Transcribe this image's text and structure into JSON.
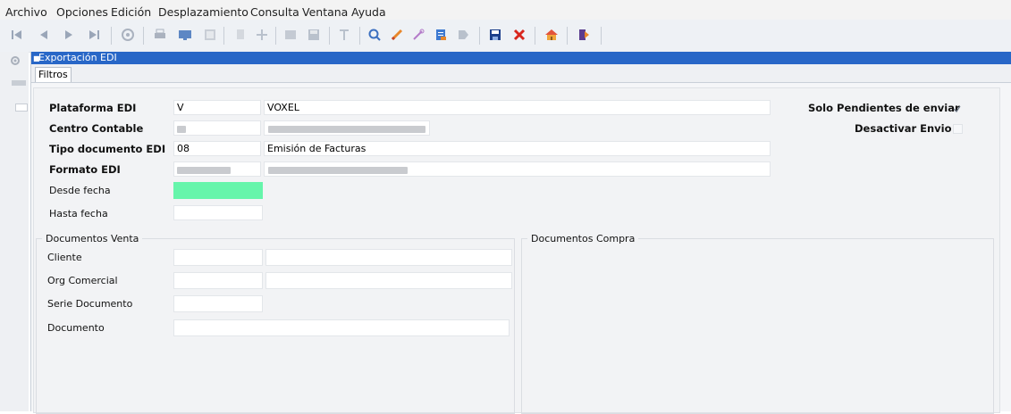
{
  "menu": [
    "Archivo",
    "Opciones",
    "Edición",
    "Desplazamiento",
    "Consulta",
    "Ventana",
    "Ayuda"
  ],
  "toolbar": {
    "icons": [
      "first-record-icon",
      "previous-record-icon",
      "next-record-icon",
      "last-record-icon",
      "globe-icon",
      "print-icon",
      "monitor-icon",
      "table-icon",
      "copy-icon",
      "add-icon",
      "form-icon",
      "save-grid-icon",
      "filter-icon",
      "search-icon",
      "pencil-icon",
      "eraser-icon",
      "document-icon",
      "tag-icon",
      "save-icon",
      "delete-icon",
      "home-icon",
      "exit-icon"
    ]
  },
  "window": {
    "title": "Exportación EDI",
    "tab": "Filtros"
  },
  "form": {
    "plataforma": {
      "label": "Plataforma EDI",
      "code": "V",
      "desc": "VOXEL"
    },
    "centro": {
      "label": "Centro Contable"
    },
    "tipo": {
      "label": "Tipo documento EDI",
      "code": "08",
      "desc": "Emisión de Facturas"
    },
    "formato": {
      "label": "Formato EDI"
    },
    "desde": {
      "label": "Desde fecha"
    },
    "hasta": {
      "label": "Hasta fecha"
    },
    "solo_pendientes": {
      "label": "Solo Pendientes de enviar",
      "checked": true
    },
    "desactivar": {
      "label": "Desactivar Envio",
      "checked": false
    }
  },
  "ventas": {
    "title": "Documentos Venta",
    "cliente": "Cliente",
    "org": "Org Comercial",
    "serie": "Serie Documento",
    "documento": "Documento"
  },
  "compras": {
    "title": "Documentos Compra"
  },
  "colors": {
    "title_bar": "#2867c7",
    "date_highlight": "#66f5ab"
  }
}
